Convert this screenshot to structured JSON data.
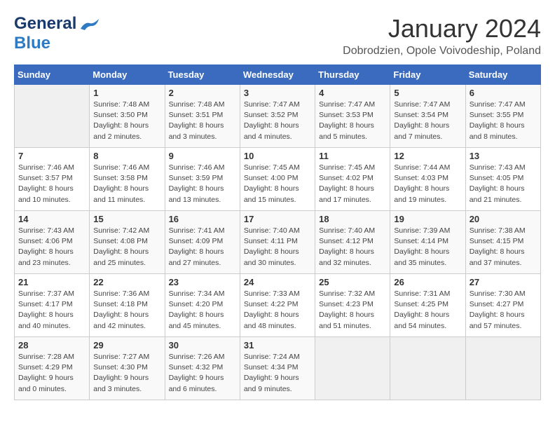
{
  "header": {
    "logo": {
      "general": "General",
      "blue": "Blue"
    },
    "title": "January 2024",
    "subtitle": "Dobrodzien, Opole Voivodeship, Poland"
  },
  "calendar": {
    "days_of_week": [
      "Sunday",
      "Monday",
      "Tuesday",
      "Wednesday",
      "Thursday",
      "Friday",
      "Saturday"
    ],
    "weeks": [
      [
        {
          "day": "",
          "info": ""
        },
        {
          "day": "1",
          "info": "Sunrise: 7:48 AM\nSunset: 3:50 PM\nDaylight: 8 hours\nand 2 minutes."
        },
        {
          "day": "2",
          "info": "Sunrise: 7:48 AM\nSunset: 3:51 PM\nDaylight: 8 hours\nand 3 minutes."
        },
        {
          "day": "3",
          "info": "Sunrise: 7:47 AM\nSunset: 3:52 PM\nDaylight: 8 hours\nand 4 minutes."
        },
        {
          "day": "4",
          "info": "Sunrise: 7:47 AM\nSunset: 3:53 PM\nDaylight: 8 hours\nand 5 minutes."
        },
        {
          "day": "5",
          "info": "Sunrise: 7:47 AM\nSunset: 3:54 PM\nDaylight: 8 hours\nand 7 minutes."
        },
        {
          "day": "6",
          "info": "Sunrise: 7:47 AM\nSunset: 3:55 PM\nDaylight: 8 hours\nand 8 minutes."
        }
      ],
      [
        {
          "day": "7",
          "info": "Sunrise: 7:46 AM\nSunset: 3:57 PM\nDaylight: 8 hours\nand 10 minutes."
        },
        {
          "day": "8",
          "info": "Sunrise: 7:46 AM\nSunset: 3:58 PM\nDaylight: 8 hours\nand 11 minutes."
        },
        {
          "day": "9",
          "info": "Sunrise: 7:46 AM\nSunset: 3:59 PM\nDaylight: 8 hours\nand 13 minutes."
        },
        {
          "day": "10",
          "info": "Sunrise: 7:45 AM\nSunset: 4:00 PM\nDaylight: 8 hours\nand 15 minutes."
        },
        {
          "day": "11",
          "info": "Sunrise: 7:45 AM\nSunset: 4:02 PM\nDaylight: 8 hours\nand 17 minutes."
        },
        {
          "day": "12",
          "info": "Sunrise: 7:44 AM\nSunset: 4:03 PM\nDaylight: 8 hours\nand 19 minutes."
        },
        {
          "day": "13",
          "info": "Sunrise: 7:43 AM\nSunset: 4:05 PM\nDaylight: 8 hours\nand 21 minutes."
        }
      ],
      [
        {
          "day": "14",
          "info": "Sunrise: 7:43 AM\nSunset: 4:06 PM\nDaylight: 8 hours\nand 23 minutes."
        },
        {
          "day": "15",
          "info": "Sunrise: 7:42 AM\nSunset: 4:08 PM\nDaylight: 8 hours\nand 25 minutes."
        },
        {
          "day": "16",
          "info": "Sunrise: 7:41 AM\nSunset: 4:09 PM\nDaylight: 8 hours\nand 27 minutes."
        },
        {
          "day": "17",
          "info": "Sunrise: 7:40 AM\nSunset: 4:11 PM\nDaylight: 8 hours\nand 30 minutes."
        },
        {
          "day": "18",
          "info": "Sunrise: 7:40 AM\nSunset: 4:12 PM\nDaylight: 8 hours\nand 32 minutes."
        },
        {
          "day": "19",
          "info": "Sunrise: 7:39 AM\nSunset: 4:14 PM\nDaylight: 8 hours\nand 35 minutes."
        },
        {
          "day": "20",
          "info": "Sunrise: 7:38 AM\nSunset: 4:15 PM\nDaylight: 8 hours\nand 37 minutes."
        }
      ],
      [
        {
          "day": "21",
          "info": "Sunrise: 7:37 AM\nSunset: 4:17 PM\nDaylight: 8 hours\nand 40 minutes."
        },
        {
          "day": "22",
          "info": "Sunrise: 7:36 AM\nSunset: 4:18 PM\nDaylight: 8 hours\nand 42 minutes."
        },
        {
          "day": "23",
          "info": "Sunrise: 7:34 AM\nSunset: 4:20 PM\nDaylight: 8 hours\nand 45 minutes."
        },
        {
          "day": "24",
          "info": "Sunrise: 7:33 AM\nSunset: 4:22 PM\nDaylight: 8 hours\nand 48 minutes."
        },
        {
          "day": "25",
          "info": "Sunrise: 7:32 AM\nSunset: 4:23 PM\nDaylight: 8 hours\nand 51 minutes."
        },
        {
          "day": "26",
          "info": "Sunrise: 7:31 AM\nSunset: 4:25 PM\nDaylight: 8 hours\nand 54 minutes."
        },
        {
          "day": "27",
          "info": "Sunrise: 7:30 AM\nSunset: 4:27 PM\nDaylight: 8 hours\nand 57 minutes."
        }
      ],
      [
        {
          "day": "28",
          "info": "Sunrise: 7:28 AM\nSunset: 4:29 PM\nDaylight: 9 hours\nand 0 minutes."
        },
        {
          "day": "29",
          "info": "Sunrise: 7:27 AM\nSunset: 4:30 PM\nDaylight: 9 hours\nand 3 minutes."
        },
        {
          "day": "30",
          "info": "Sunrise: 7:26 AM\nSunset: 4:32 PM\nDaylight: 9 hours\nand 6 minutes."
        },
        {
          "day": "31",
          "info": "Sunrise: 7:24 AM\nSunset: 4:34 PM\nDaylight: 9 hours\nand 9 minutes."
        },
        {
          "day": "",
          "info": ""
        },
        {
          "day": "",
          "info": ""
        },
        {
          "day": "",
          "info": ""
        }
      ]
    ]
  }
}
